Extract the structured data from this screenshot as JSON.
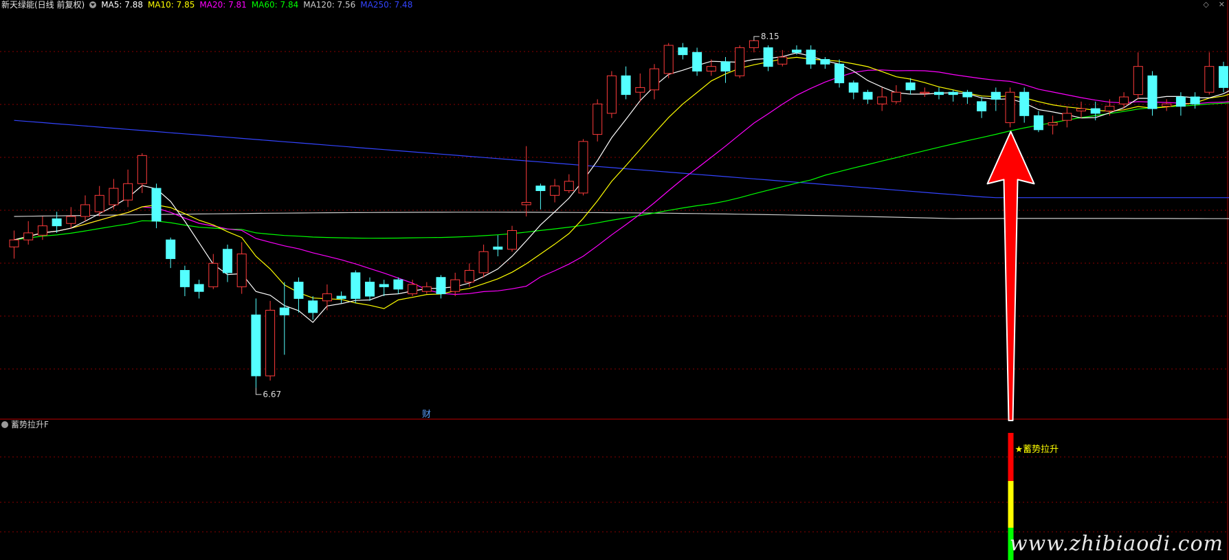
{
  "header": {
    "title": "新天绿能(日线 前复权)",
    "indicators": [
      {
        "label": "MA5: 7.88",
        "color": "#ffffff"
      },
      {
        "label": "MA10: 7.85",
        "color": "#ffff00"
      },
      {
        "label": "MA20: 7.81",
        "color": "#ff00ff"
      },
      {
        "label": "MA60: 7.84",
        "color": "#00ff00"
      },
      {
        "label": "MA120: 7.56",
        "color": "#cccccc"
      },
      {
        "label": "MA250: 7.48",
        "color": "#3344ff"
      }
    ],
    "corner_icons": [
      "diamond-icon",
      "close-icon"
    ]
  },
  "sub_panel": {
    "title": "蓄势拉升F"
  },
  "watermark": "www.zhibiaodi.com",
  "chart_data": {
    "type": "candlestick",
    "y_range": [
      6.55,
      8.3
    ],
    "annotations": {
      "high_label": "8.15",
      "low_label": "6.67",
      "finance_marker": "财",
      "signal_label": "★蓄势拉升"
    },
    "signal_index": 70,
    "candles": [
      [
        7.27,
        7.3,
        7.34,
        7.22
      ],
      [
        7.3,
        7.33,
        7.38,
        7.28
      ],
      [
        7.32,
        7.36,
        7.4,
        7.3
      ],
      [
        7.39,
        7.36,
        7.42,
        7.33
      ],
      [
        7.37,
        7.4,
        7.44,
        7.35
      ],
      [
        7.4,
        7.45,
        7.49,
        7.38
      ],
      [
        7.42,
        7.49,
        7.53,
        7.4
      ],
      [
        7.45,
        7.52,
        7.56,
        7.43
      ],
      [
        7.47,
        7.54,
        7.6,
        7.44
      ],
      [
        7.54,
        7.66,
        7.67,
        7.5
      ],
      [
        7.52,
        7.38,
        7.54,
        7.35
      ],
      [
        7.3,
        7.22,
        7.31,
        7.18
      ],
      [
        7.17,
        7.1,
        7.19,
        7.06
      ],
      [
        7.11,
        7.08,
        7.13,
        7.05
      ],
      [
        7.1,
        7.2,
        7.24,
        7.09
      ],
      [
        7.26,
        7.16,
        7.28,
        7.12
      ],
      [
        7.1,
        7.24,
        7.29,
        7.07
      ],
      [
        6.98,
        6.72,
        7.05,
        6.67
      ],
      [
        6.72,
        7.0,
        7.04,
        6.7
      ],
      [
        7.01,
        6.98,
        7.12,
        6.81
      ],
      [
        7.12,
        7.05,
        7.14,
        6.99
      ],
      [
        7.04,
        6.99,
        7.06,
        6.96
      ],
      [
        7.04,
        7.07,
        7.11,
        7.0
      ],
      [
        7.06,
        7.05,
        7.08,
        7.03
      ],
      [
        7.16,
        7.05,
        7.17,
        7.03
      ],
      [
        7.12,
        7.06,
        7.14,
        7.04
      ],
      [
        7.11,
        7.1,
        7.13,
        7.06
      ],
      [
        7.13,
        7.09,
        7.14,
        7.07
      ],
      [
        7.07,
        7.11,
        7.13,
        7.06
      ],
      [
        7.08,
        7.1,
        7.12,
        7.07
      ],
      [
        7.14,
        7.07,
        7.15,
        7.05
      ],
      [
        7.08,
        7.13,
        7.16,
        7.06
      ],
      [
        7.12,
        7.17,
        7.2,
        7.1
      ],
      [
        7.16,
        7.25,
        7.28,
        7.14
      ],
      [
        7.27,
        7.26,
        7.32,
        7.23
      ],
      [
        7.26,
        7.34,
        7.36,
        7.25
      ],
      [
        7.45,
        7.46,
        7.7,
        7.4
      ],
      [
        7.53,
        7.51,
        7.54,
        7.43
      ],
      [
        7.49,
        7.53,
        7.56,
        7.46
      ],
      [
        7.51,
        7.55,
        7.58,
        7.5
      ],
      [
        7.5,
        7.72,
        7.73,
        7.49
      ],
      [
        7.75,
        7.88,
        7.9,
        7.72
      ],
      [
        7.84,
        8.0,
        8.02,
        7.82
      ],
      [
        8.0,
        7.92,
        8.04,
        7.9
      ],
      [
        7.93,
        7.95,
        8.01,
        7.89
      ],
      [
        7.94,
        8.03,
        8.05,
        7.9
      ],
      [
        8.01,
        8.13,
        8.14,
        7.99
      ],
      [
        8.12,
        8.09,
        8.14,
        8.07
      ],
      [
        8.1,
        8.02,
        8.12,
        8.0
      ],
      [
        8.02,
        8.04,
        8.07,
        8.0
      ],
      [
        8.06,
        8.02,
        8.08,
        7.97
      ],
      [
        8.0,
        8.12,
        8.13,
        7.99
      ],
      [
        8.12,
        8.15,
        8.15,
        8.1
      ],
      [
        8.12,
        8.04,
        8.13,
        8.02
      ],
      [
        8.05,
        8.08,
        8.11,
        8.04
      ],
      [
        8.11,
        8.1,
        8.13,
        8.09
      ],
      [
        8.11,
        8.05,
        8.13,
        8.03
      ],
      [
        8.07,
        8.05,
        8.08,
        8.03
      ],
      [
        8.05,
        7.97,
        8.07,
        7.95
      ],
      [
        7.97,
        7.93,
        7.98,
        7.9
      ],
      [
        7.93,
        7.9,
        7.94,
        7.88
      ],
      [
        7.88,
        7.91,
        7.95,
        7.85
      ],
      [
        7.89,
        7.93,
        7.96,
        7.88
      ],
      [
        7.97,
        7.94,
        7.99,
        7.92
      ],
      [
        7.93,
        7.93,
        7.95,
        7.91
      ],
      [
        7.93,
        7.92,
        7.95,
        7.9
      ],
      [
        7.93,
        7.92,
        7.94,
        7.89
      ],
      [
        7.93,
        7.91,
        7.94,
        7.88
      ],
      [
        7.89,
        7.85,
        7.91,
        7.82
      ],
      [
        7.93,
        7.9,
        7.95,
        7.85
      ],
      [
        7.8,
        7.93,
        7.95,
        7.78
      ],
      [
        7.93,
        7.83,
        7.95,
        7.8
      ],
      [
        7.83,
        7.77,
        7.85,
        7.76
      ],
      [
        7.79,
        7.8,
        7.83,
        7.75
      ],
      [
        7.81,
        7.84,
        7.87,
        7.78
      ],
      [
        7.85,
        7.86,
        7.89,
        7.82
      ],
      [
        7.86,
        7.84,
        7.89,
        7.81
      ],
      [
        7.85,
        7.87,
        7.9,
        7.83
      ],
      [
        7.88,
        7.91,
        7.93,
        7.86
      ],
      [
        7.92,
        8.04,
        8.1,
        7.9
      ],
      [
        8.0,
        7.86,
        8.02,
        7.83
      ],
      [
        7.87,
        7.88,
        7.9,
        7.85
      ],
      [
        7.91,
        7.87,
        7.93,
        7.83
      ],
      [
        7.91,
        7.88,
        7.93,
        7.86
      ],
      [
        7.93,
        8.04,
        8.1,
        7.92
      ],
      [
        8.04,
        7.95,
        8.06,
        7.93
      ],
      [
        8.02,
        8.03,
        8.05,
        8.01
      ],
      [
        8.01,
        7.97,
        8.03,
        7.95
      ],
      [
        7.97,
        7.95,
        8.0,
        7.93
      ]
    ],
    "ma_values": {
      "MA5": 7.88,
      "MA10": 7.85,
      "MA20": 7.81,
      "MA60": 7.84,
      "MA120": 7.56,
      "MA250": 7.48
    },
    "ma250_series_from": 7.81
  },
  "colors": {
    "up": "#ff3b3b",
    "down": "#54ffff",
    "grid": "#8b0000",
    "arrow": "#ff0000",
    "ma5": "#ffffff",
    "ma10": "#ffff00",
    "ma20": "#ff00ff",
    "ma60": "#00ff00",
    "ma120": "#cccccc",
    "ma250": "#3344ff",
    "signal_red": "#ff0000",
    "signal_yellow": "#ffff00",
    "signal_green": "#00ff00"
  }
}
